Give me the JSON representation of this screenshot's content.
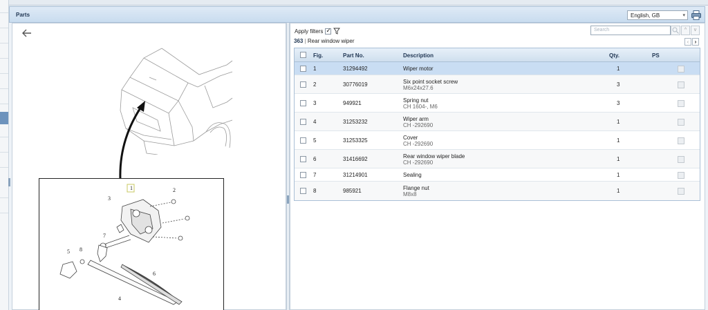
{
  "header": {
    "title": "Parts",
    "language": "English, GB"
  },
  "filters": {
    "label": "Apply filters",
    "checked": true,
    "search_placeholder": "Search"
  },
  "group": {
    "number": "363",
    "separator": "|",
    "name": "Rear window wiper"
  },
  "table": {
    "columns": [
      "Fig.",
      "Part No.",
      "Description",
      "Qty.",
      "PS"
    ],
    "rows": [
      {
        "fig": "1",
        "part": "31294492",
        "desc": "Wiper motor",
        "sub": "",
        "qty": "1",
        "selected": true
      },
      {
        "fig": "2",
        "part": "30776019",
        "desc": "Six point socket screw",
        "sub": "M6x24x27.6",
        "qty": "3"
      },
      {
        "fig": "3",
        "part": "949921",
        "desc": "Spring nut",
        "sub": "CH 1604-, M6",
        "qty": "3"
      },
      {
        "fig": "4",
        "part": "31253232",
        "desc": "Wiper arm",
        "sub": "CH -292690",
        "qty": "1"
      },
      {
        "fig": "5",
        "part": "31253325",
        "desc": "Cover",
        "sub": "CH -292690",
        "qty": "1"
      },
      {
        "fig": "6",
        "part": "31416692",
        "desc": "Rear window wiper blade",
        "sub": "CH -292690",
        "qty": "1"
      },
      {
        "fig": "7",
        "part": "31214901",
        "desc": "Sealing",
        "sub": "",
        "qty": "1"
      },
      {
        "fig": "8",
        "part": "985921",
        "desc": "Flange nut",
        "sub": "M8x8",
        "qty": "1"
      }
    ]
  },
  "diagram": {
    "callouts": [
      "1",
      "2",
      "3",
      "4",
      "5",
      "6",
      "7",
      "8"
    ]
  },
  "colors": {
    "header_bg": "#c9dcef",
    "selected_row": "#c9ddf3",
    "title_text": "#1f3552"
  }
}
